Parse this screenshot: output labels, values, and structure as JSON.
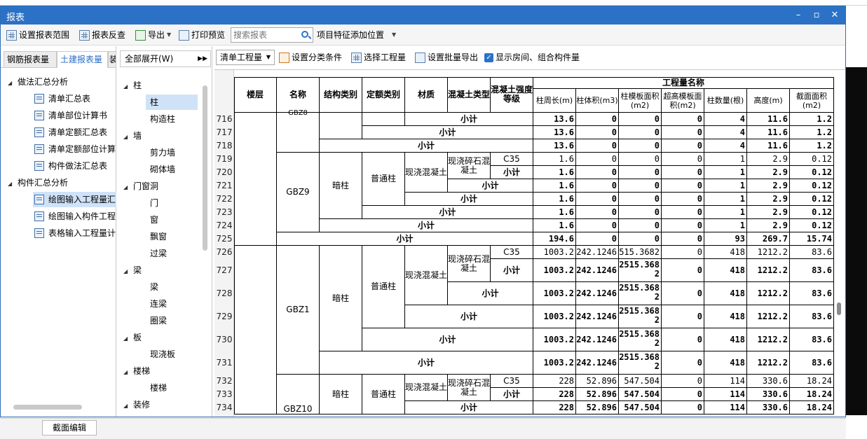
{
  "window": {
    "title": "报表"
  },
  "toolbar": {
    "items": [
      "设置报表范围",
      "报表反查",
      "导出",
      "打印预览",
      "项目特征添加位置"
    ],
    "search_placeholder": "搜索报表"
  },
  "left_tabs": [
    "钢筋报表量",
    "土建报表量",
    "装"
  ],
  "left_tree": {
    "group1": "做法汇总分析",
    "group1_items": [
      "清单汇总表",
      "清单部位计算书",
      "清单定额汇总表",
      "清单定额部位计算",
      "构件做法汇总表"
    ],
    "group2": "构件汇总分析",
    "group2_items": [
      "绘图输入工程量汇",
      "绘图输入构件工程",
      "表格输入工程量计"
    ]
  },
  "mid_panel": {
    "header": "全部展开(W)",
    "categories": [
      {
        "name": "柱",
        "items": [
          "柱",
          "构造柱"
        ]
      },
      {
        "name": "墙",
        "items": [
          "剪力墙",
          "砌体墙"
        ]
      },
      {
        "name": "门窗洞",
        "items": [
          "门",
          "窗",
          "飘窗",
          "过梁"
        ]
      },
      {
        "name": "梁",
        "items": [
          "梁",
          "连梁",
          "圈梁"
        ]
      },
      {
        "name": "板",
        "items": [
          "现浇板"
        ]
      },
      {
        "name": "楼梯",
        "items": [
          "楼梯"
        ]
      },
      {
        "name": "装修",
        "items": []
      }
    ]
  },
  "toolbar2": {
    "combo": "清单工程量",
    "items": [
      "设置分类条件",
      "选择工程量",
      "设置批量导出",
      "显示房间、组合构件量"
    ]
  },
  "table": {
    "headers": [
      "楼层",
      "名称",
      "结构类别",
      "定额类别",
      "材质",
      "混凝土类型",
      "混凝土强度等级",
      "工程量名称"
    ],
    "sub_headers": [
      "柱周长(m)",
      "柱体积(m3)",
      "柱模板面积(m2)",
      "超高模板面积(m2)",
      "柱数量(根)",
      "高度(m)",
      "截面面积(m2)"
    ],
    "row_numbers": [
      "716",
      "717",
      "718",
      "719",
      "720",
      "721",
      "722",
      "723",
      "724",
      "725",
      "726",
      "727",
      "728",
      "729",
      "730",
      "731",
      "732",
      "733",
      "734"
    ],
    "labels": {
      "name_gbz8": "GBZ8",
      "name_gbz9": "GBZ9",
      "name_gbz1": "GBZ1",
      "name_gbz10": "GBZ10",
      "struct": "暗柱",
      "quota": "普通柱",
      "material": "现浇混凝土",
      "concrete_type": "现浇碎石混凝土",
      "grade": "C35",
      "subtotal": "小计"
    },
    "rows": [
      [
        "13.6",
        "0",
        "0",
        "0",
        "4",
        "11.6",
        "1.2"
      ],
      [
        "13.6",
        "0",
        "0",
        "0",
        "4",
        "11.6",
        "1.2"
      ],
      [
        "13.6",
        "0",
        "0",
        "0",
        "4",
        "11.6",
        "1.2"
      ],
      [
        "1.6",
        "0",
        "0",
        "0",
        "1",
        "2.9",
        "0.12"
      ],
      [
        "1.6",
        "0",
        "0",
        "0",
        "1",
        "2.9",
        "0.12"
      ],
      [
        "1.6",
        "0",
        "0",
        "0",
        "1",
        "2.9",
        "0.12"
      ],
      [
        "1.6",
        "0",
        "0",
        "0",
        "1",
        "2.9",
        "0.12"
      ],
      [
        "1.6",
        "0",
        "0",
        "0",
        "1",
        "2.9",
        "0.12"
      ],
      [
        "1.6",
        "0",
        "0",
        "0",
        "1",
        "2.9",
        "0.12"
      ],
      [
        "194.6",
        "0",
        "0",
        "0",
        "93",
        "269.7",
        "15.74"
      ],
      [
        "1003.2",
        "242.1246",
        "2515.3682",
        "0",
        "418",
        "1212.2",
        "83.6"
      ],
      [
        "1003.2",
        "242.1246",
        "2515.3682",
        "0",
        "418",
        "1212.2",
        "83.6"
      ],
      [
        "1003.2",
        "242.1246",
        "2515.3682",
        "0",
        "418",
        "1212.2",
        "83.6"
      ],
      [
        "1003.2",
        "242.1246",
        "2515.3682",
        "0",
        "418",
        "1212.2",
        "83.6"
      ],
      [
        "1003.2",
        "242.1246",
        "2515.3682",
        "0",
        "418",
        "1212.2",
        "83.6"
      ],
      [
        "1003.2",
        "242.1246",
        "2515.3682",
        "0",
        "418",
        "1212.2",
        "83.6"
      ],
      [
        "228",
        "52.896",
        "547.504",
        "0",
        "114",
        "330.6",
        "18.24"
      ],
      [
        "228",
        "52.896",
        "547.504",
        "0",
        "114",
        "330.6",
        "18.24"
      ],
      [
        "228",
        "52.896",
        "547.504",
        "0",
        "114",
        "330.6",
        "18.24"
      ]
    ]
  },
  "bottom": {
    "tab": "截面编辑"
  }
}
